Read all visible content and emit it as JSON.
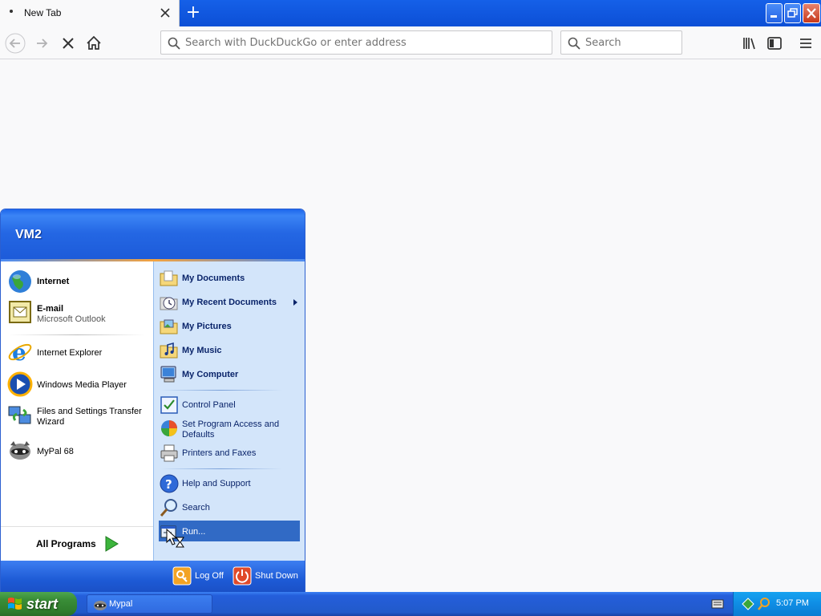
{
  "browser": {
    "tab_title": "New Tab",
    "url_placeholder": "Search with DuckDuckGo or enter address",
    "search_placeholder": "Search"
  },
  "start_menu": {
    "user_name": "VM2",
    "pinned": [
      {
        "label": "Internet",
        "sublabel": "",
        "icon": "globe-icon"
      },
      {
        "label": "E-mail",
        "sublabel": "Microsoft Outlook",
        "icon": "outlook-icon"
      }
    ],
    "recent": [
      {
        "label": "Internet Explorer",
        "icon": "ie-icon"
      },
      {
        "label": "Windows Media Player",
        "icon": "media-player-icon"
      },
      {
        "label": "Files and Settings Transfer Wizard",
        "icon": "transfer-wizard-icon"
      },
      {
        "label": "MyPal 68",
        "icon": "mypal-icon"
      }
    ],
    "all_programs": "All Programs",
    "places": [
      {
        "label": "My Documents",
        "icon": "folder-documents-icon"
      },
      {
        "label": "My Recent Documents",
        "icon": "recent-documents-icon"
      },
      {
        "label": "My Pictures",
        "icon": "folder-pictures-icon"
      },
      {
        "label": "My Music",
        "icon": "folder-music-icon"
      },
      {
        "label": "My Computer",
        "icon": "computer-icon"
      }
    ],
    "settings": [
      {
        "label": "Control Panel",
        "icon": "control-panel-icon"
      },
      {
        "label": "Set Program Access and Defaults",
        "icon": "program-access-icon"
      },
      {
        "label": "Printers and Faxes",
        "icon": "printer-icon"
      }
    ],
    "tools": [
      {
        "label": "Help and Support",
        "icon": "help-icon"
      },
      {
        "label": "Search",
        "icon": "search-icon"
      },
      {
        "label": "Run...",
        "icon": "run-icon"
      }
    ],
    "log_off": "Log Off",
    "shut_down": "Shut Down"
  },
  "taskbar": {
    "start_label": "start",
    "task_label": "Mypal",
    "clock": "5:07 PM"
  }
}
